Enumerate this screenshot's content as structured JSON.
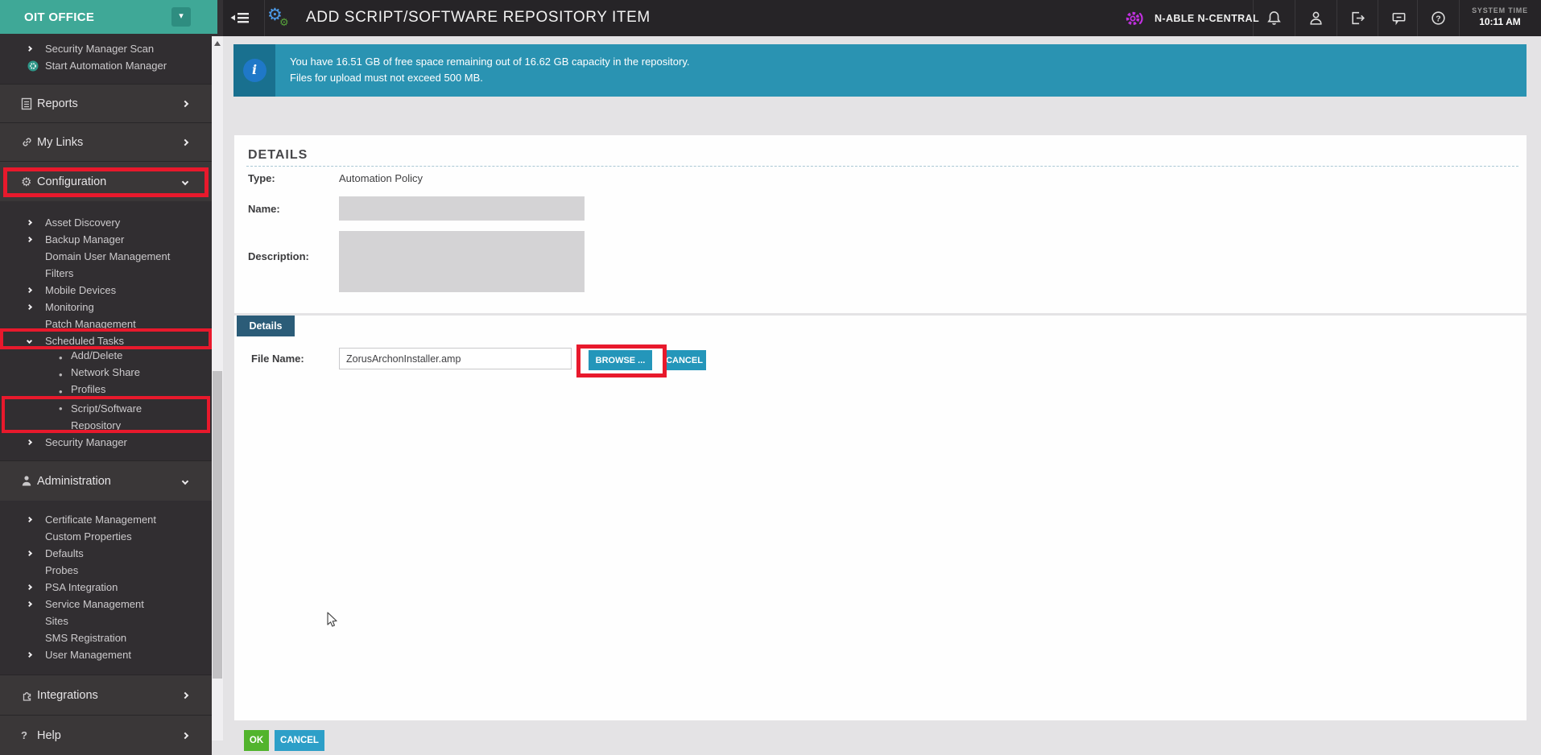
{
  "topbar": {
    "title": "ADD SCRIPT/SOFTWARE REPOSITORY ITEM",
    "brand": "N-ABLE N-CENTRAL",
    "system_time_label": "SYSTEM TIME",
    "system_time": "10:11 AM"
  },
  "sidebar": {
    "org": "OIT OFFICE",
    "items": [
      {
        "label": "Security Manager Scan"
      },
      {
        "label": "Start Automation Manager"
      },
      {
        "label": "Reports"
      },
      {
        "label": "My Links"
      },
      {
        "label": "Configuration"
      },
      {
        "label": "Asset Discovery"
      },
      {
        "label": "Backup Manager"
      },
      {
        "label": "Domain User Management"
      },
      {
        "label": "Filters"
      },
      {
        "label": "Mobile Devices"
      },
      {
        "label": "Monitoring"
      },
      {
        "label": "Patch Management"
      },
      {
        "label": "Scheduled Tasks"
      },
      {
        "label": "Add/Delete"
      },
      {
        "label": "Network Share"
      },
      {
        "label": "Profiles"
      },
      {
        "label": "Script/Software Repository"
      },
      {
        "label": "Security Manager"
      },
      {
        "label": "Administration"
      },
      {
        "label": "Certificate Management"
      },
      {
        "label": "Custom Properties"
      },
      {
        "label": "Defaults"
      },
      {
        "label": "Probes"
      },
      {
        "label": "PSA Integration"
      },
      {
        "label": "Service Management"
      },
      {
        "label": "Sites"
      },
      {
        "label": "SMS Registration"
      },
      {
        "label": "User Management"
      },
      {
        "label": "Integrations"
      },
      {
        "label": "Help"
      }
    ]
  },
  "banner": {
    "line1": "You have 16.51 GB of free space remaining out of 16.62 GB capacity in the repository.",
    "line2": "Files for upload must not exceed 500 MB."
  },
  "details_card": {
    "heading": "DETAILS",
    "type_label": "Type:",
    "type_value": "Automation Policy",
    "name_label": "Name:",
    "description_label": "Description:"
  },
  "file_card": {
    "tab_label": "Details",
    "file_label": "File Name:",
    "file_value": "ZorusArchonInstaller.amp",
    "browse_label": "BROWSE ...",
    "cancel_label": "CANCEL"
  },
  "footer": {
    "ok_label": "OK",
    "cancel_label": "CANCEL"
  },
  "colors": {
    "org_teal": "#3FA897",
    "banner_blue": "#2A93B2",
    "tab_slate": "#2B5C78",
    "button_blue": "#2496BA",
    "ok_green": "#52B42D",
    "annotation_red": "#E8192C",
    "brand_magenta": "#C130E0"
  }
}
